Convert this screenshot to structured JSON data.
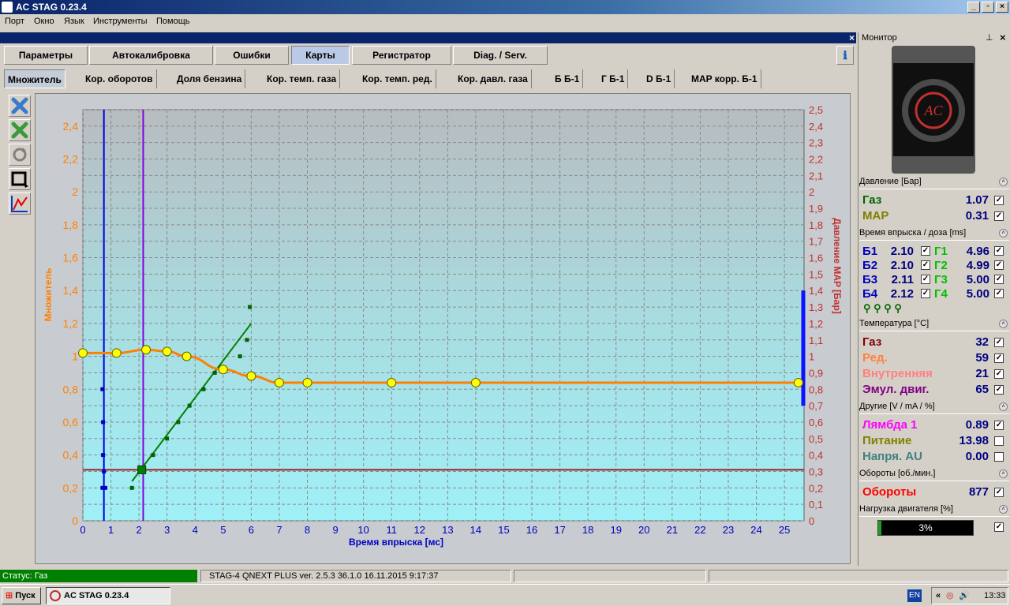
{
  "window": {
    "title": "AC STAG 0.23.4"
  },
  "menu": [
    "Порт",
    "Окно",
    "Язык",
    "Инструменты",
    "Помощь"
  ],
  "tabs": [
    "Параметры",
    "Автокалибровка",
    "Ошибки",
    "Карты",
    "Регистратор",
    "Diag. / Serv."
  ],
  "active_tab": "Карты",
  "subtabs": [
    "Множитель",
    "Кор. оборотов",
    "Доля бензина",
    "Кор. темп. газа",
    "Кор. темп. ред.",
    "Кор. давл. газа",
    "Б Б-1",
    "Г Б-1",
    "D Б-1",
    "MAP корр. Б-1"
  ],
  "active_subtab": "Множитель",
  "toolbar": {
    "icons": [
      "close-blue-icon",
      "close-green-icon",
      "refresh-icon",
      "frame-icon",
      "graph-icon"
    ]
  },
  "chart_data": {
    "type": "line",
    "xlabel": "Время впрыска [мс]",
    "ylabel": "Множитель",
    "y2label": "Давление MAP [Бар]",
    "xlim": [
      0,
      25.7
    ],
    "ylim": [
      0,
      2.5
    ],
    "y2lim": [
      0,
      2.5
    ],
    "x_ticks": [
      0,
      1,
      2,
      3,
      4,
      5,
      6,
      7,
      8,
      9,
      10,
      11,
      12,
      13,
      14,
      15,
      16,
      17,
      18,
      19,
      20,
      21,
      22,
      23,
      24,
      25
    ],
    "y_ticks": [
      "0",
      "0,2",
      "0,4",
      "0,6",
      "0,8",
      "1",
      "1,2",
      "1,4",
      "1,6",
      "1,8",
      "2",
      "2,2",
      "2,4"
    ],
    "y_tick_values": [
      0,
      0.2,
      0.4,
      0.6,
      0.8,
      1,
      1.2,
      1.4,
      1.6,
      1.8,
      2,
      2.2,
      2.4
    ],
    "y2_ticks": [
      "0",
      "0,1",
      "0,2",
      "0,3",
      "0,4",
      "0,5",
      "0,6",
      "0,7",
      "0,8",
      "0,9",
      "1",
      "1,1",
      "1,2",
      "1,3",
      "1,4",
      "1,5",
      "1,6",
      "1,7",
      "1,8",
      "1,9",
      "2",
      "2,1",
      "2,2",
      "2,3",
      "2,4",
      "2,5"
    ],
    "y2_tick_values": [
      0,
      0.1,
      0.2,
      0.3,
      0.4,
      0.5,
      0.6,
      0.7,
      0.8,
      0.9,
      1,
      1.1,
      1.2,
      1.3,
      1.4,
      1.5,
      1.6,
      1.7,
      1.8,
      1.9,
      2,
      2.1,
      2.2,
      2.3,
      2.4,
      2.5
    ],
    "grid": true,
    "multiplier_curve": {
      "x": [
        0,
        1.2,
        2.25,
        3,
        3.7,
        5,
        6,
        7,
        8,
        11,
        14,
        25.5
      ],
      "y": [
        1.02,
        1.02,
        1.04,
        1.03,
        1.0,
        0.92,
        0.88,
        0.84,
        0.84,
        0.84,
        0.84,
        0.84
      ]
    },
    "gas_points": {
      "x": [
        1.75,
        2.1,
        2.5,
        3,
        3.4,
        3.8,
        4.3,
        4.7,
        5.6,
        5.85,
        5.95
      ],
      "y": [
        0.2,
        0.3,
        0.4,
        0.5,
        0.6,
        0.7,
        0.8,
        0.9,
        1.0,
        1.1,
        1.3
      ]
    },
    "gas_fit": {
      "x": [
        1.75,
        6.0
      ],
      "y": [
        0.24,
        1.2
      ]
    },
    "petrol_points": {
      "x": [
        0.7,
        0.72,
        0.7,
        0.72,
        0.75,
        0.8
      ],
      "y": [
        0.2,
        0.6,
        0.8,
        0.4,
        0.3,
        0.2
      ]
    },
    "cursor_blue_x": 0.75,
    "cursor_violet_x": 2.15,
    "map_line_y": 0.31,
    "current_point": {
      "x": 2.1,
      "y": 0.31
    },
    "map_range_bar": [
      0.7,
      1.4
    ]
  },
  "monitor": {
    "title": "Монитор",
    "sections": {
      "pressure": "Давление [Бар]",
      "injection": "Время впрыска / доза [ms]",
      "temperature": "Температура [°C]",
      "other": "Другие [V / mA / %]",
      "rpm": "Обороты [об./мин.]",
      "load": "Нагрузка двигателя [%]"
    },
    "pressure": [
      {
        "label": "Газ",
        "value": "1.07"
      },
      {
        "label": "MAP",
        "value": "0.31"
      }
    ],
    "injection": [
      {
        "b": "Б1",
        "bv": "2.10",
        "g": "Г1",
        "gv": "4.96"
      },
      {
        "b": "Б2",
        "bv": "2.10",
        "g": "Г2",
        "gv": "4.99"
      },
      {
        "b": "Б3",
        "bv": "2.11",
        "g": "Г3",
        "gv": "5.00"
      },
      {
        "b": "Б4",
        "bv": "2.12",
        "g": "Г4",
        "gv": "5.00"
      }
    ],
    "temperature": [
      {
        "label": "Газ",
        "value": "32"
      },
      {
        "label": "Ред.",
        "value": "59"
      },
      {
        "label": "Внутренняя",
        "value": "21"
      },
      {
        "label": "Эмул. двиг.",
        "value": "65"
      }
    ],
    "other": [
      {
        "label": "Лямбда 1",
        "value": "0.89"
      },
      {
        "label": "Питание",
        "value": "13.98"
      },
      {
        "label": "Напря. AU",
        "value": "0.00"
      }
    ],
    "rpm": {
      "label": "Обороты",
      "value": "877"
    },
    "load": {
      "text": "3%",
      "fraction": 0.03
    },
    "colors": {
      "gas": "#006400",
      "map": "#808000",
      "b": "#0000c0",
      "g": "#00c000",
      "temp_gas": "#800000",
      "temp_red": "#ff8040",
      "temp_int": "#ff8080",
      "temp_emul": "#800080",
      "lambda": "#ff00ff",
      "power": "#808000",
      "voltage": "#408080",
      "rpm": "#ff0000"
    }
  },
  "status": {
    "left": "Статус: Газ",
    "device": "STAG-4 QNEXT PLUS  ver. 2.5.3  36.1.0   16.11.2015 9:17:37"
  },
  "taskbar": {
    "start": "Пуск",
    "task": "AC STAG 0.23.4",
    "lang": "EN",
    "clock": "13:33",
    "tray_prefix": "«"
  }
}
